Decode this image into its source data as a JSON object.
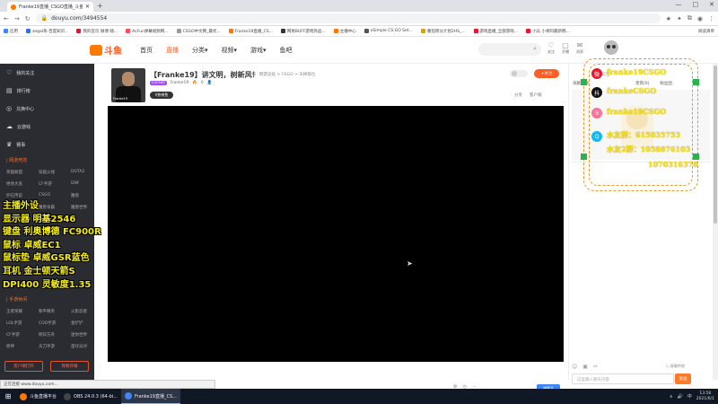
{
  "browser": {
    "tab_title": "Franke19直播_CSGO直播_斗鱼",
    "new_tab": "+",
    "url": "douyu.com/3494554",
    "window_controls": [
      "—",
      "□",
      "✕"
    ],
    "bookmarks": [
      {
        "label": "应用",
        "color": "#4285f4"
      },
      {
        "label": "zegal系-百度知识...",
        "color": "#2d6ff7"
      },
      {
        "label": "我的首页 微博-随...",
        "color": "#e6162d"
      },
      {
        "label": "AcFun弹幕视频网...",
        "color": "#fd4c5d"
      },
      {
        "label": "CSGO中文网_最优...",
        "color": "#999999"
      },
      {
        "label": "Franke19直播_CS...",
        "color": "#ff7700"
      },
      {
        "label": "网易BUFF游戏饰品...",
        "color": "#333333"
      },
      {
        "label": "主播中心",
        "color": "#ff7700"
      },
      {
        "label": "xSimple CS:GO Set...",
        "color": "#555555"
      },
      {
        "label": "番茄积分计划2HS_...",
        "color": "#e0a000"
      },
      {
        "label": "游戏直播_全部游戏...",
        "color": "#e6162d"
      },
      {
        "label": "小兵 小将阿最新韩...",
        "color": "#e6162d"
      }
    ],
    "reading_list": "阅读清单",
    "status_text": "正在连接 www.douyu.com...",
    "scrollbar_thumb_fraction": 0.5
  },
  "site": {
    "logo": "斗鱼",
    "nav": [
      {
        "label": "首页",
        "active": false
      },
      {
        "label": "直播",
        "active": true
      },
      {
        "label": "分类▾",
        "active": false
      },
      {
        "label": "视频▾",
        "active": false
      },
      {
        "label": "游戏▾",
        "active": false
      },
      {
        "label": "鱼吧",
        "active": false
      }
    ],
    "search_icon": "⌕",
    "header_icons": [
      {
        "icon": "♡",
        "label": "关注"
      },
      {
        "icon": "▢",
        "label": "开播"
      },
      {
        "icon": "✉",
        "label": "消息"
      }
    ]
  },
  "sidebar": {
    "items": [
      {
        "icon": "♡",
        "label": "我的关注"
      },
      {
        "icon": "▤",
        "label": "排行榜"
      },
      {
        "icon": "◎",
        "label": "兑换中心"
      },
      {
        "icon": "☁",
        "label": "云游戏"
      },
      {
        "icon": "♛",
        "label": "赛事"
      }
    ],
    "group_title": "| 网游竞技",
    "games": [
      "英雄联盟",
      "穿越火线",
      "DOTA2",
      "绝地大逃",
      "CF手游",
      "DNF",
      "炉石传说",
      "CSGO",
      "魔兽",
      "DOTA",
      "魔兽争霸",
      "魔兽世界"
    ],
    "mobile_title": "| 手游休闲",
    "mobile_games": [
      "王者荣耀",
      "和平精英",
      "火影忍者",
      "LOL手游",
      "COD手游",
      "金铲铲",
      "CF手游",
      "明日方舟",
      "迷你世界",
      "原神",
      "天刀手游",
      "蛋仔派对"
    ],
    "buttons": [
      "客户端打开",
      "我要开播"
    ]
  },
  "overlay": {
    "lines": [
      "主播外设",
      "显示器  明基2546",
      "键盘  利奥博德 FC900R",
      "鼠标  卓威EC1",
      "鼠标垫  卓威GSR蓝色",
      "耳机  金士顿天箭S",
      "DPI400  灵敏度1.35"
    ]
  },
  "room": {
    "avatar_caption": "Franke19",
    "title": "【Franke19】讲文明，树新风！",
    "tags": [
      "举报",
      "网游竞技 > CSGO > 天梯排位"
    ],
    "badge": "CS:GO",
    "streamer": "Franke19",
    "fans": "0",
    "sub_badge": "V热带鱼",
    "follow": "+关注",
    "share": [
      "分享",
      "客户端"
    ]
  },
  "player": {
    "controls": [
      "⚙",
      "◷",
      "⋯"
    ],
    "button": "弹幕开"
  },
  "right_panel": {
    "header": "主播公告",
    "tabs": [
      "贡献周榜",
      "贵宾(0)",
      "粉丝团"
    ],
    "social": [
      {
        "icon": "微",
        "text": "franke19CSGO",
        "color": "#e6162d"
      },
      {
        "icon": "抖",
        "text": "frankeCSGO",
        "color": "#111111"
      },
      {
        "icon": "B",
        "text": "franke19CSGO",
        "color": "#fb7299"
      },
      {
        "icon": "Q",
        "text": "水友群：615035753",
        "color": "#12b7f5"
      },
      {
        "icon": "",
        "text": "水友2群：1058876103",
        "color": "#12b7f5"
      },
      {
        "icon": "",
        "text": "1070316378",
        "color": "#12b7f5"
      }
    ],
    "chat_tools": [
      "☺",
      "▣",
      "✂"
    ],
    "chat_check": "屏蔽特效",
    "chat_placeholder": "这里输入聊天内容",
    "send": "发送"
  },
  "taskbar": {
    "start": "⊞",
    "apps": [
      {
        "label": "斗鱼直播平台",
        "color": "#ff7700",
        "active": false
      },
      {
        "label": "OBS 24.0.3 (64-bi...",
        "color": "#444444",
        "active": false
      },
      {
        "label": "Franke19直播_CS...",
        "color": "#4285f4",
        "active": true
      }
    ],
    "tray": [
      "∧",
      "🔊",
      "中"
    ],
    "time": "13:56",
    "date": "2021/6/1"
  }
}
